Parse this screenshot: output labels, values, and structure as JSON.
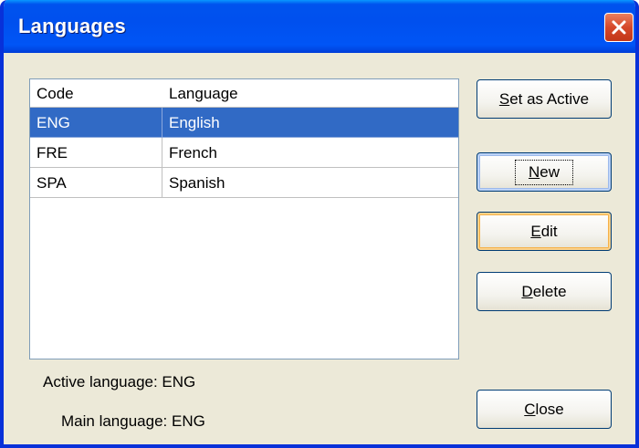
{
  "window": {
    "title": "Languages"
  },
  "list": {
    "headers": {
      "code": "Code",
      "language": "Language"
    },
    "rows": [
      {
        "code": "ENG",
        "language": "English",
        "selected": true
      },
      {
        "code": "FRE",
        "language": "French",
        "selected": false
      },
      {
        "code": "SPA",
        "language": "Spanish",
        "selected": false
      }
    ]
  },
  "buttons": {
    "set_active": {
      "mnemonic": "S",
      "rest": "et as Active"
    },
    "new": {
      "mnemonic": "N",
      "rest": "ew"
    },
    "edit": {
      "mnemonic": "E",
      "rest": "dit"
    },
    "delete": {
      "mnemonic": "D",
      "rest": "elete"
    },
    "close": {
      "mnemonic": "C",
      "rest": "lose"
    }
  },
  "status": {
    "active_language": "Active language: ENG",
    "main_language": "Main language: ENG"
  },
  "colors": {
    "titlebar": "#0055ea",
    "selection": "#316ac5",
    "dialog_bg": "#ece9d8",
    "close_button": "#d6482a"
  },
  "icons": {
    "close": "close-icon"
  }
}
